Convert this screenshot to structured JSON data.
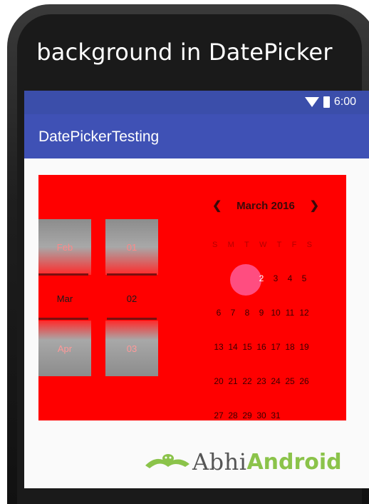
{
  "caption": "background in DatePicker",
  "status": {
    "time": "6:00"
  },
  "appbar": {
    "title": "DatePickerTesting"
  },
  "spinner": {
    "month": {
      "prev": "Feb",
      "current": "Mar",
      "next": "Apr"
    },
    "day": {
      "prev": "01",
      "current": "02",
      "next": "03"
    }
  },
  "calendar": {
    "month_label": "March 2016",
    "weekdays": [
      "S",
      "M",
      "T",
      "W",
      "T",
      "F",
      "S"
    ],
    "selected_day": "2",
    "rows": [
      [
        "",
        "",
        "",
        "2",
        "3",
        "4",
        "5"
      ],
      [
        "6",
        "7",
        "8",
        "9",
        "10",
        "11",
        "12"
      ],
      [
        "13",
        "14",
        "15",
        "16",
        "17",
        "18",
        "19"
      ],
      [
        "20",
        "21",
        "22",
        "23",
        "24",
        "25",
        "26"
      ],
      [
        "27",
        "28",
        "29",
        "30",
        "31",
        "",
        ""
      ]
    ]
  },
  "logo": {
    "part1": "Abhi",
    "part2": "Android"
  },
  "colors": {
    "statusbar": "#3b4eaa",
    "appbar": "#3f51b5",
    "picker_bg": "#ff0000",
    "selected": "#ff4d80"
  }
}
